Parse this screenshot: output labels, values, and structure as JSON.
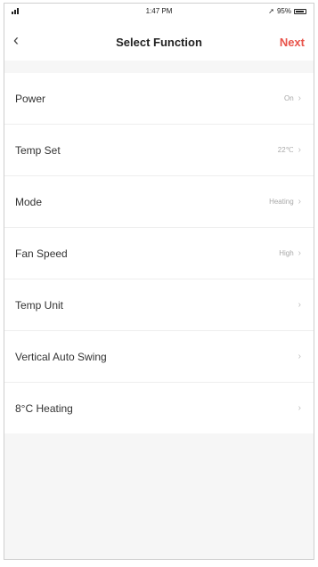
{
  "status_bar": {
    "time": "1:47 PM",
    "battery": "95%"
  },
  "nav": {
    "back_icon": "chevron-left-icon",
    "title": "Select Function",
    "next_label": "Next",
    "next_color": "#e8534a"
  },
  "functions": [
    {
      "label": "Power",
      "value": "On"
    },
    {
      "label": "Temp Set",
      "value": "22℃"
    },
    {
      "label": "Mode",
      "value": "Heating"
    },
    {
      "label": "Fan Speed",
      "value": "High"
    },
    {
      "label": "Temp Unit",
      "value": ""
    },
    {
      "label": "Vertical Auto Swing",
      "value": ""
    },
    {
      "label": "8°C Heating",
      "value": ""
    }
  ]
}
